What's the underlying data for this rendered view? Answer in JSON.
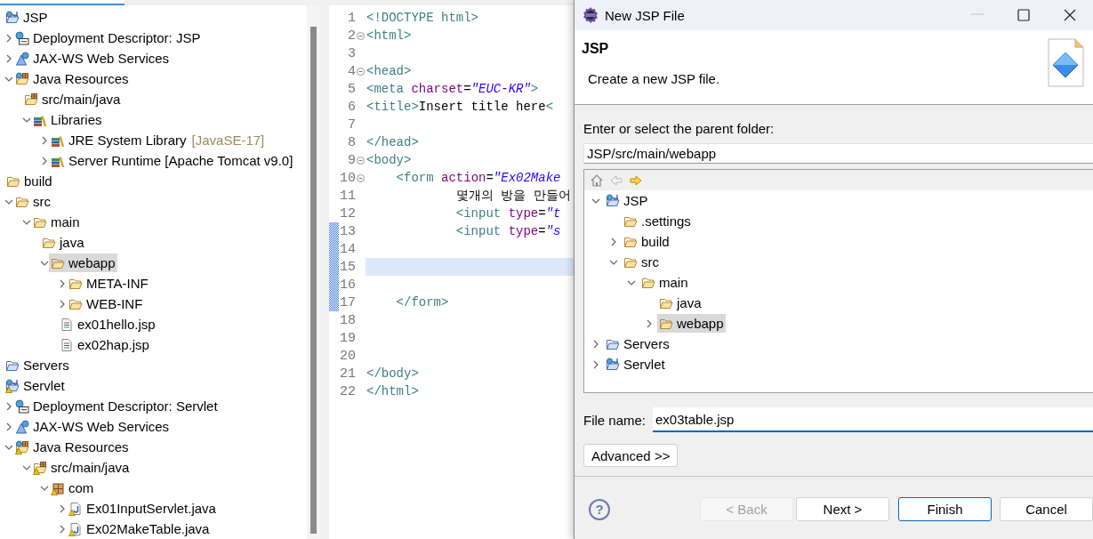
{
  "explorer": {
    "tree": [
      {
        "label": "JSP",
        "kind": "project",
        "warning": false,
        "selected": false,
        "children": [
          {
            "label": "Deployment Descriptor: JSP",
            "kind": "descriptor",
            "warning": false,
            "selected": false,
            "expanded": false
          },
          {
            "label": "JAX-WS Web Services",
            "kind": "webservice",
            "warning": false,
            "selected": false,
            "expanded": false
          },
          {
            "label": "Java Resources",
            "kind": "javares",
            "warning": false,
            "selected": false,
            "expanded": true,
            "children": [
              {
                "label": "src/main/java",
                "kind": "srcfolder",
                "warning": false,
                "selected": false
              },
              {
                "label": "Libraries",
                "kind": "library",
                "warning": false,
                "selected": false,
                "expanded": true,
                "children": [
                  {
                    "label": "JRE System Library",
                    "decoration": "[JavaSE-17]",
                    "kind": "library",
                    "warning": false,
                    "selected": false,
                    "expanded": false
                  },
                  {
                    "label": "Server Runtime [Apache Tomcat v9.0]",
                    "kind": "library",
                    "warning": false,
                    "selected": false,
                    "expanded": false
                  }
                ]
              }
            ]
          },
          {
            "label": "build",
            "kind": "folder",
            "warning": false,
            "selected": false
          },
          {
            "label": "src",
            "kind": "folder",
            "warning": false,
            "selected": false,
            "expanded": true,
            "children": [
              {
                "label": "main",
                "kind": "folder",
                "warning": false,
                "selected": false,
                "expanded": true,
                "children": [
                  {
                    "label": "java",
                    "kind": "folder",
                    "warning": false,
                    "selected": false
                  },
                  {
                    "label": "webapp",
                    "kind": "folder",
                    "warning": false,
                    "selected": true,
                    "expanded": true,
                    "children": [
                      {
                        "label": "META-INF",
                        "kind": "folder",
                        "warning": false,
                        "selected": false,
                        "expanded": false
                      },
                      {
                        "label": "WEB-INF",
                        "kind": "folder",
                        "warning": false,
                        "selected": false,
                        "expanded": false
                      },
                      {
                        "label": "ex01hello.jsp",
                        "kind": "jsp",
                        "warning": false,
                        "selected": false
                      },
                      {
                        "label": "ex02hap.jsp",
                        "kind": "jsp",
                        "warning": false,
                        "selected": false
                      }
                    ]
                  }
                ]
              }
            ]
          }
        ]
      },
      {
        "label": "Servers",
        "kind": "servers",
        "warning": false,
        "selected": false
      },
      {
        "label": "Servlet",
        "kind": "project",
        "warning": true,
        "selected": false,
        "children": [
          {
            "label": "Deployment Descriptor: Servlet",
            "kind": "descriptor",
            "warning": false,
            "selected": false,
            "expanded": false
          },
          {
            "label": "JAX-WS Web Services",
            "kind": "webservice",
            "warning": false,
            "selected": false,
            "expanded": false
          },
          {
            "label": "Java Resources",
            "kind": "javares",
            "warning": true,
            "selected": false,
            "expanded": true,
            "children": [
              {
                "label": "src/main/java",
                "kind": "srcfolder",
                "warning": true,
                "selected": false,
                "expanded": true,
                "children": [
                  {
                    "label": "com",
                    "kind": "package",
                    "warning": true,
                    "selected": false,
                    "expanded": true,
                    "children": [
                      {
                        "label": "Ex01InputServlet.java",
                        "kind": "javafile",
                        "warning": true,
                        "selected": false,
                        "expanded": false
                      },
                      {
                        "label": "Ex02MakeTable.java",
                        "kind": "javafile",
                        "warning": true,
                        "selected": false,
                        "expanded": false
                      }
                    ]
                  }
                ]
              }
            ]
          }
        ]
      }
    ]
  },
  "editor": {
    "lines": [
      {
        "number": "1",
        "fold": false,
        "marked": false,
        "current": false,
        "tokens": [
          {
            "kind": "tag",
            "text": "<!DOCTYPE html>"
          }
        ]
      },
      {
        "number": "2",
        "fold": true,
        "marked": false,
        "current": false,
        "tokens": [
          {
            "kind": "tag",
            "text": "<html>"
          }
        ]
      },
      {
        "number": "3",
        "fold": false,
        "marked": false,
        "current": false
      },
      {
        "number": "4",
        "fold": true,
        "marked": false,
        "current": false,
        "tokens": [
          {
            "kind": "tag",
            "text": "<head>"
          }
        ]
      },
      {
        "number": "5",
        "fold": false,
        "marked": false,
        "current": false,
        "tokens": [
          {
            "kind": "tag",
            "text": "<meta"
          },
          {
            "kind": "attr",
            "text": " charset"
          },
          {
            "kind": "text",
            "text": "="
          },
          {
            "kind": "value",
            "text": "\"EUC-KR\""
          },
          {
            "kind": "tag",
            "text": ">"
          }
        ]
      },
      {
        "number": "6",
        "fold": false,
        "marked": false,
        "current": false,
        "tokens": [
          {
            "kind": "tag",
            "text": "<title>"
          },
          {
            "kind": "text",
            "text": "Insert title here"
          },
          {
            "kind": "tag",
            "text": "<"
          }
        ]
      },
      {
        "number": "7",
        "fold": false,
        "marked": false,
        "current": false
      },
      {
        "number": "8",
        "fold": false,
        "marked": false,
        "current": false,
        "tokens": [
          {
            "kind": "tag",
            "text": "</head>"
          }
        ]
      },
      {
        "number": "9",
        "fold": true,
        "marked": false,
        "current": false,
        "tokens": [
          {
            "kind": "tag",
            "text": "<body>"
          }
        ]
      },
      {
        "number": "10",
        "fold": true,
        "marked": false,
        "current": false,
        "tokens": [
          {
            "kind": "tag",
            "text": "    <form"
          },
          {
            "kind": "attr",
            "text": " action"
          },
          {
            "kind": "text",
            "text": "="
          },
          {
            "kind": "value",
            "text": "\"Ex02Make"
          }
        ]
      },
      {
        "number": "11",
        "fold": false,
        "marked": false,
        "current": false,
        "tokens": [
          {
            "kind": "text",
            "text": "            몇개의 방을 만들어"
          }
        ]
      },
      {
        "number": "12",
        "fold": false,
        "marked": false,
        "current": false,
        "tokens": [
          {
            "kind": "tag",
            "text": "            <input"
          },
          {
            "kind": "attr",
            "text": " type"
          },
          {
            "kind": "text",
            "text": "="
          },
          {
            "kind": "value",
            "text": "\"t"
          }
        ]
      },
      {
        "number": "13",
        "fold": false,
        "marked": true,
        "current": false,
        "tokens": [
          {
            "kind": "tag",
            "text": "            <input"
          },
          {
            "kind": "attr",
            "text": " type"
          },
          {
            "kind": "text",
            "text": "="
          },
          {
            "kind": "value",
            "text": "\"s"
          }
        ]
      },
      {
        "number": "14",
        "fold": false,
        "marked": true,
        "current": false
      },
      {
        "number": "15",
        "fold": false,
        "marked": true,
        "current": true
      },
      {
        "number": "16",
        "fold": false,
        "marked": true,
        "current": false
      },
      {
        "number": "17",
        "fold": false,
        "marked": true,
        "current": false,
        "tokens": [
          {
            "kind": "tag",
            "text": "    </form>"
          }
        ]
      },
      {
        "number": "18",
        "fold": false,
        "marked": false,
        "current": false
      },
      {
        "number": "19",
        "fold": false,
        "marked": false,
        "current": false
      },
      {
        "number": "20",
        "fold": false,
        "marked": false,
        "current": false
      },
      {
        "number": "21",
        "fold": false,
        "marked": false,
        "current": false,
        "tokens": [
          {
            "kind": "tag",
            "text": "</body>"
          }
        ]
      },
      {
        "number": "22",
        "fold": false,
        "marked": false,
        "current": false,
        "tokens": [
          {
            "kind": "tag",
            "text": "</html>"
          }
        ]
      }
    ]
  },
  "dialog": {
    "title": "New JSP File",
    "heading": "JSP",
    "description": "Create a new JSP file.",
    "folder_label": "Enter or select the parent folder:",
    "folder_value": "JSP/src/main/webapp",
    "toolbar": [
      {
        "kind": "home",
        "disabled": false
      },
      {
        "kind": "back",
        "disabled": true
      },
      {
        "kind": "forward",
        "disabled": false
      }
    ],
    "tree": [
      {
        "label": "JSP",
        "kind": "project",
        "selected": false,
        "expanded": true,
        "children": [
          {
            "label": ".settings",
            "kind": "folder",
            "selected": false
          },
          {
            "label": "build",
            "kind": "folder",
            "selected": false,
            "expanded": false
          },
          {
            "label": "src",
            "kind": "folder",
            "selected": false,
            "expanded": true,
            "children": [
              {
                "label": "main",
                "kind": "folder",
                "selected": false,
                "expanded": true,
                "children": [
                  {
                    "label": "java",
                    "kind": "folder",
                    "selected": false
                  },
                  {
                    "label": "webapp",
                    "kind": "folder",
                    "selected": true,
                    "expanded": false
                  }
                ]
              }
            ]
          }
        ]
      },
      {
        "label": "Servers",
        "kind": "servers",
        "selected": false,
        "expanded": false
      },
      {
        "label": "Servlet",
        "kind": "project",
        "selected": false,
        "expanded": false
      }
    ],
    "file_name_label": "File name:",
    "file_name_value": "ex03table.jsp",
    "advanced_button": "Advanced >>",
    "help": "?",
    "buttons": [
      {
        "label": "< Back",
        "disabled": true,
        "default": false
      },
      {
        "label": "Next >",
        "disabled": false,
        "default": false
      },
      {
        "label": "Finish",
        "disabled": false,
        "default": true
      },
      {
        "label": "Cancel",
        "disabled": false,
        "default": false
      }
    ]
  }
}
